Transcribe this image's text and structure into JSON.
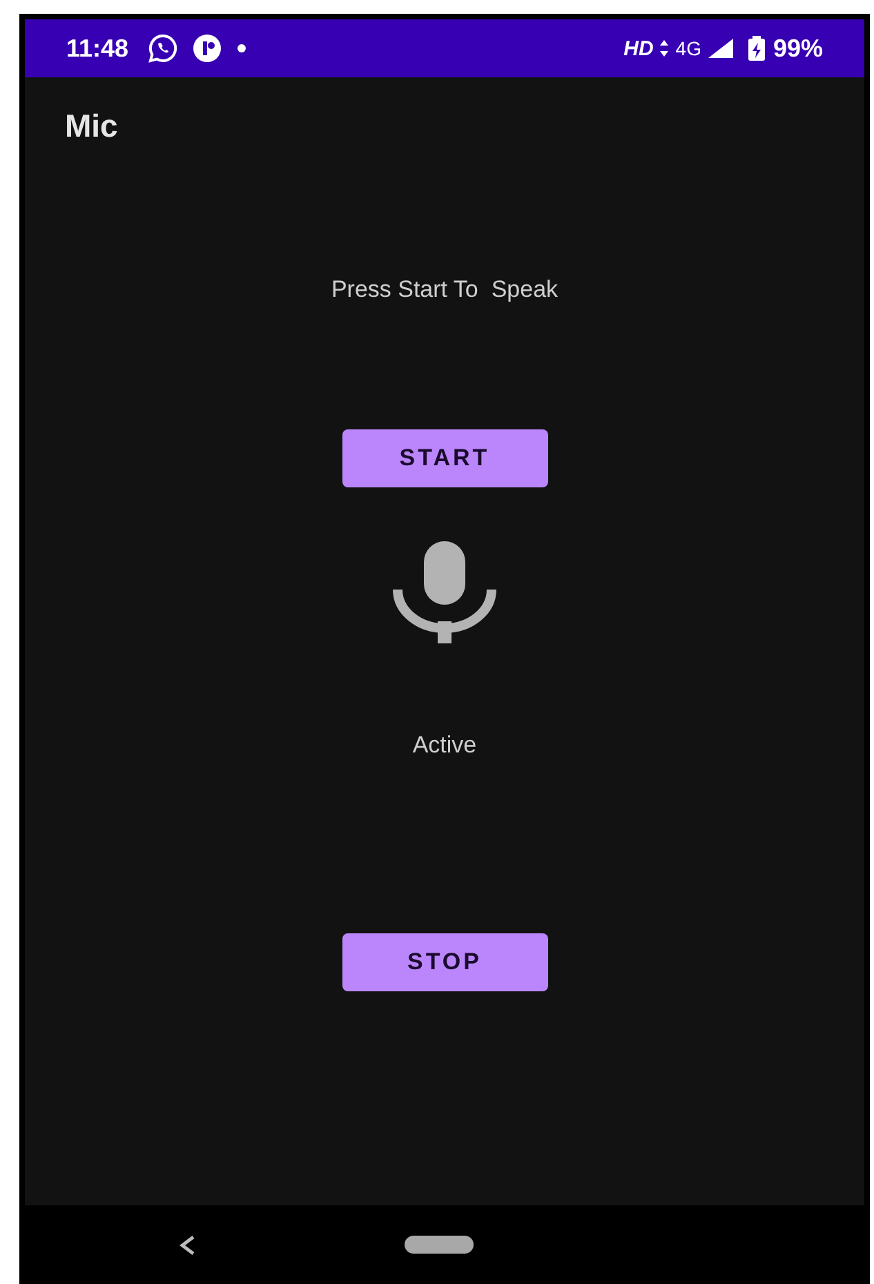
{
  "status_bar": {
    "time": "11:48",
    "network_label": "HD",
    "network_type": "4G",
    "battery": "99%"
  },
  "app_bar": {
    "title": "Mic"
  },
  "prompt": "Press Start To  Speak",
  "buttons": [
    {
      "label": "START"
    },
    {
      "label": "STOP"
    }
  ],
  "status_text": "Active"
}
